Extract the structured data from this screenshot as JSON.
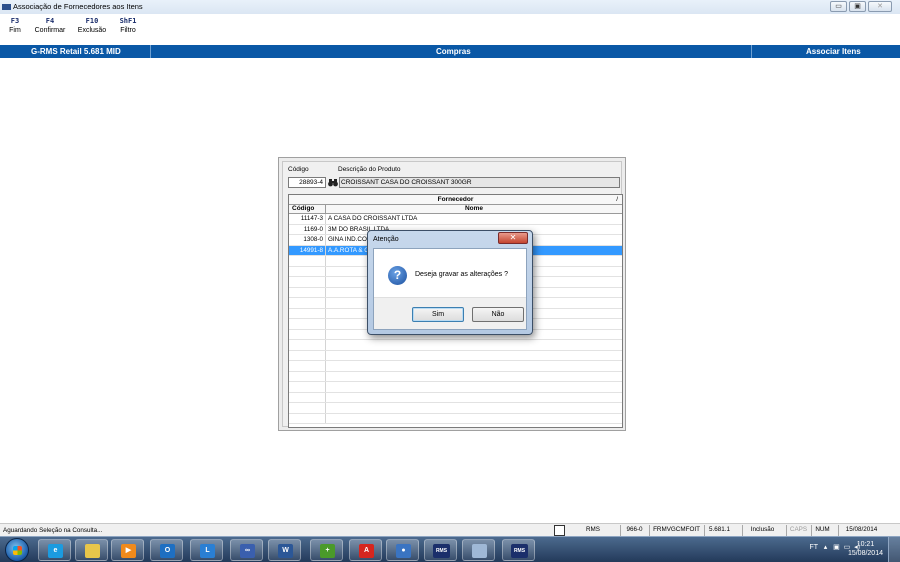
{
  "window": {
    "title": "Associação de Fornecedores aos Itens",
    "minimize": "▭",
    "maximize": "▣",
    "close": "✕"
  },
  "toolbar": [
    {
      "key": "F3",
      "label": "Fim"
    },
    {
      "key": "F4",
      "label": "Confirmar"
    },
    {
      "key": "F10",
      "label": "Exclusão"
    },
    {
      "key": "ShF1",
      "label": "Filtro"
    }
  ],
  "header": {
    "left": "G-RMS Retail 5.681 MID",
    "center": "Compras",
    "right": "Associar Itens"
  },
  "form": {
    "codigo_label": "Código",
    "descricao_label": "Descrição do Produto",
    "codigo_value": "28893-4",
    "descricao_value": "CROISSANT CASA DO CROISSANT 300GR"
  },
  "grid": {
    "group_header": "Fornecedor",
    "group_marker": "/",
    "col_codigo": "Código",
    "col_nome": "Nome",
    "rows": [
      {
        "codigo": "11147-3",
        "nome": "A CASA DO CROISSANT LTDA"
      },
      {
        "codigo": "1169-0",
        "nome": "3M DO BRASIL LTDA"
      },
      {
        "codigo": "1308-0",
        "nome": "GINA IND.COM"
      },
      {
        "codigo": "14991-8",
        "nome": "A.A.ROTA & C"
      }
    ]
  },
  "dialog": {
    "title": "Atenção",
    "close": "✕",
    "icon": "?",
    "message": "Deseja gravar as alterações ?",
    "yes": "Sim",
    "no": "Não"
  },
  "status": {
    "message": "Aguardando Seleção na Consulta...",
    "rms": "RMS",
    "code": "966-0",
    "form": "FRMVGCMFOIT",
    "version": "5.681.1",
    "mode": "Inclusão",
    "caps": "CAPS",
    "num": "NUM",
    "date": "15/08/2014"
  },
  "taskbar": {
    "tray_lang": "FT",
    "time": "10:21",
    "date": "15/08/2014",
    "apps": [
      {
        "name": "ie-icon",
        "glyph": "e",
        "color": "#1b9be0"
      },
      {
        "name": "explorer-icon",
        "glyph": "",
        "color": "#e8c64a"
      },
      {
        "name": "media-player-icon",
        "glyph": "▶",
        "color": "#f08a1c"
      },
      {
        "name": "outlook-icon",
        "glyph": "O",
        "color": "#1e6fc2"
      },
      {
        "name": "lync-icon",
        "glyph": "L",
        "color": "#2a7fd4"
      },
      {
        "name": "app-infinity-icon",
        "glyph": "∞",
        "color": "#3a5fae"
      },
      {
        "name": "word-icon",
        "glyph": "W",
        "color": "#2b5797"
      },
      {
        "name": "app-green-icon",
        "glyph": "+",
        "color": "#4a9a2a"
      },
      {
        "name": "acrobat-icon",
        "glyph": "A",
        "color": "#d6261f"
      },
      {
        "name": "app-blue-circle-icon",
        "glyph": "●",
        "color": "#3a74c2"
      },
      {
        "name": "rms-icon",
        "glyph": "RMS",
        "color": "#1b2f6b"
      },
      {
        "name": "app-document-icon",
        "glyph": "",
        "color": "#9fb8d6"
      },
      {
        "name": "rms-2-icon",
        "glyph": "RMS",
        "color": "#1b2f6b"
      }
    ]
  }
}
